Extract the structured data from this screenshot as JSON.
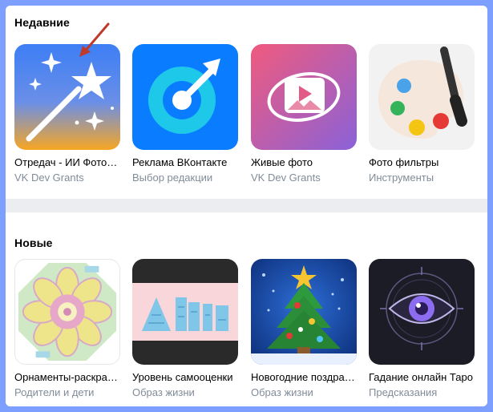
{
  "recent": {
    "title": "Недавние",
    "apps": [
      {
        "name": "Отредач - ИИ Фоторедактор",
        "sub": "VK Dev Grants",
        "icon": "magic-wand-icon"
      },
      {
        "name": "Реклама ВКонтакте",
        "sub": "Выбор редакции",
        "icon": "target-icon"
      },
      {
        "name": "Живые фото",
        "sub": "VK Dev Grants",
        "icon": "live-photo-icon"
      },
      {
        "name": "Фото фильтры",
        "sub": "Инструменты",
        "icon": "palette-icon"
      }
    ]
  },
  "new": {
    "title": "Новые",
    "apps": [
      {
        "name": "Орнаменты-раскраски",
        "sub": "Родители и дети",
        "icon": "mandala-icon"
      },
      {
        "name": "Уровень самооценки",
        "sub": "Образ жизни",
        "icon": "self-esteem-icon"
      },
      {
        "name": "Новогодние поздравления",
        "sub": "Образ жизни",
        "icon": "christmas-tree-icon"
      },
      {
        "name": "Гадание онлайн Таро",
        "sub": "Предсказания",
        "icon": "eye-icon"
      }
    ]
  },
  "colors": {
    "background": "#7d9fff",
    "divider": "#ebedf0",
    "subtitle": "#818c99",
    "arrow": "#c0392b"
  }
}
